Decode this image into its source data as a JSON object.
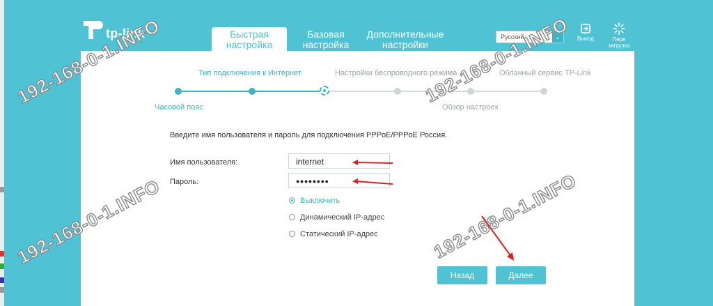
{
  "brand": {
    "name": "tp-link",
    "icon": "tp-link-logo-icon"
  },
  "tabs": [
    {
      "line1": "Быстрая",
      "line2": "настройка",
      "active": true
    },
    {
      "line1": "Базовая",
      "line2": "настройка",
      "active": false
    },
    {
      "line1": "Дополнительные",
      "line2": "настройки",
      "active": false
    }
  ],
  "language": {
    "value": "Русский"
  },
  "header_buttons": {
    "logout": {
      "label": "Выход",
      "icon": "logout-icon"
    },
    "reboot": {
      "line1": "Пере",
      "line2": "загрузка",
      "icon": "reboot-icon"
    }
  },
  "wizard": {
    "steps_top": [
      "Тип подключения к Интернет",
      "Настройки беспроводного режима",
      "Облачный сервис TP-Link"
    ],
    "steps_bottom": [
      "Часовой пояс",
      "Обзор настроек"
    ]
  },
  "form": {
    "intro": "Введите имя пользователя и пароль для подключения PPPoE/PPPoE Россия.",
    "username_label": "Имя пользователя:",
    "username_value": "internet",
    "password_label": "Пароль:",
    "password_value": "●●●●●●●●",
    "options": [
      {
        "label": "Выключить",
        "selected": true
      },
      {
        "label": "Динамический IP-адрес",
        "selected": false
      },
      {
        "label": "Статический IP-адрес",
        "selected": false
      }
    ]
  },
  "buttons": {
    "back": "Назад",
    "next": "Далее"
  },
  "watermark": "192-168-0-1.INFO",
  "colors": {
    "accent": "#4fc3d3",
    "arrow": "#e02020"
  }
}
